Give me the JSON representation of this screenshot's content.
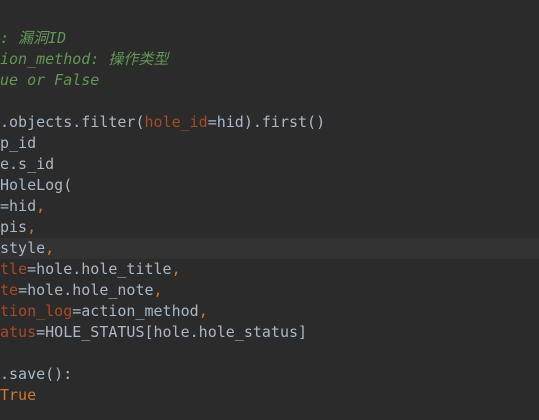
{
  "lines": [
    {
      "row": 1,
      "tokens": [
        {
          "t": ": 漏洞ID",
          "c": "comment"
        }
      ]
    },
    {
      "row": 2,
      "tokens": [
        {
          "t": "ion_method: 操作类型",
          "c": "comment"
        }
      ]
    },
    {
      "row": 3,
      "tokens": [
        {
          "t": "ue or False",
          "c": "comment"
        }
      ]
    },
    {
      "row": 4,
      "tokens": [
        {
          "t": "",
          "c": "default"
        }
      ]
    },
    {
      "row": 5,
      "tokens": [
        {
          "t": ".objects.filter(",
          "c": "default"
        },
        {
          "t": "hole_id",
          "c": "param"
        },
        {
          "t": "=hid).first()",
          "c": "default"
        }
      ]
    },
    {
      "row": 6,
      "tokens": [
        {
          "t": "p_id",
          "c": "default"
        }
      ]
    },
    {
      "row": 7,
      "tokens": [
        {
          "t": "e.s_id",
          "c": "default"
        }
      ]
    },
    {
      "row": 8,
      "tokens": [
        {
          "t": "HoleLog(",
          "c": "default"
        }
      ]
    },
    {
      "row": 9,
      "tokens": [
        {
          "t": "=hid",
          "c": "default"
        },
        {
          "t": ",",
          "c": "kw"
        }
      ]
    },
    {
      "row": 10,
      "tokens": [
        {
          "t": "pis",
          "c": "default"
        },
        {
          "t": ",",
          "c": "kw"
        }
      ]
    },
    {
      "row": 11,
      "tokens": [
        {
          "t": "style",
          "c": "default"
        },
        {
          "t": ",",
          "c": "kw"
        }
      ]
    },
    {
      "row": 12,
      "tokens": [
        {
          "t": "tle",
          "c": "param"
        },
        {
          "t": "=hole.hole_title",
          "c": "default"
        },
        {
          "t": ",",
          "c": "kw"
        }
      ]
    },
    {
      "row": 13,
      "tokens": [
        {
          "t": "te",
          "c": "param"
        },
        {
          "t": "=hole.hole_note",
          "c": "default"
        },
        {
          "t": ",",
          "c": "kw"
        }
      ]
    },
    {
      "row": 14,
      "tokens": [
        {
          "t": "tion_log",
          "c": "param"
        },
        {
          "t": "=action_method",
          "c": "default"
        },
        {
          "t": ",",
          "c": "kw"
        }
      ]
    },
    {
      "row": 15,
      "tokens": [
        {
          "t": "atus",
          "c": "param"
        },
        {
          "t": "=HOLE_STATUS[hole.hole_status]",
          "c": "default"
        }
      ]
    },
    {
      "row": 16,
      "tokens": [
        {
          "t": "",
          "c": "default"
        }
      ]
    },
    {
      "row": 17,
      "tokens": [
        {
          "t": ".save():",
          "c": "default"
        }
      ]
    },
    {
      "row": 18,
      "tokens": [
        {
          "t": "True",
          "c": "kw"
        }
      ]
    }
  ],
  "current_line_row": 11,
  "colors": {
    "background": "#2b2b2b",
    "current_line": "#323232",
    "comment": "#629755",
    "default": "#a9b7c6",
    "keyword": "#cc7832",
    "param": "#aa4926"
  }
}
